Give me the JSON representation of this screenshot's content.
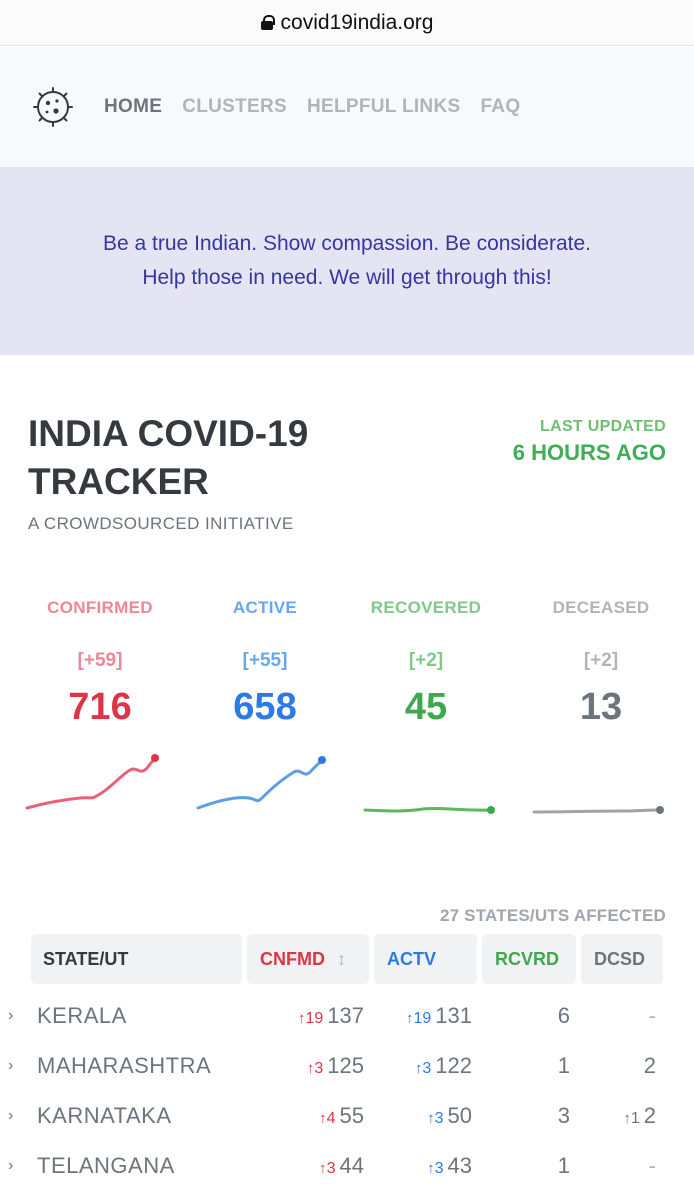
{
  "browser": {
    "url": "covid19india.org"
  },
  "nav": {
    "items": [
      {
        "label": "HOME",
        "active": true
      },
      {
        "label": "CLUSTERS",
        "active": false
      },
      {
        "label": "HELPFUL LINKS",
        "active": false
      },
      {
        "label": "FAQ",
        "active": false
      }
    ]
  },
  "banner": {
    "message": "Be a true Indian. Show compassion. Be considerate. Help those in need. We will get through this!"
  },
  "header": {
    "title": "INDIA COVID-19 TRACKER",
    "subtitle": "A CROWDSOURCED INITIATIVE",
    "last_updated_label": "LAST UPDATED",
    "last_updated_value": "6 HOURS AGO"
  },
  "stats": [
    {
      "label": "CONFIRMED",
      "delta": "[+59]",
      "value": "716",
      "color": "#dc3545",
      "label_color": "#f08596"
    },
    {
      "label": "ACTIVE",
      "delta": "[+55]",
      "value": "658",
      "color": "#2c7be5",
      "label_color": "#66a8ef"
    },
    {
      "label": "RECOVERED",
      "delta": "[+2]",
      "value": "45",
      "color": "#3fa84f",
      "label_color": "#7fc98a"
    },
    {
      "label": "DECEASED",
      "delta": "[+2]",
      "value": "13",
      "color": "#6c757d",
      "label_color": "#b0b5ba"
    }
  ],
  "table": {
    "affected": "27 STATES/UTS AFFECTED",
    "headers": {
      "state": "STATE/UT",
      "confirmed": "CNFMD",
      "active": "ACTV",
      "recovered": "RCVRD",
      "deceased": "DCSD"
    },
    "colors": {
      "confirmed": "#dc3545",
      "active": "#2c7be5",
      "recovered": "#3fa84f",
      "deceased": "#6c757d"
    },
    "rows": [
      {
        "state": "KERALA",
        "confirmed_delta": "19",
        "confirmed": "137",
        "active_delta": "19",
        "active": "131",
        "recovered": "6",
        "deceased_delta": "",
        "deceased": "-"
      },
      {
        "state": "MAHARASHTRA",
        "confirmed_delta": "3",
        "confirmed": "125",
        "active_delta": "3",
        "active": "122",
        "recovered": "1",
        "deceased_delta": "",
        "deceased": "2"
      },
      {
        "state": "KARNATAKA",
        "confirmed_delta": "4",
        "confirmed": "55",
        "active_delta": "3",
        "active": "50",
        "recovered": "3",
        "deceased_delta": "1",
        "deceased": "2"
      },
      {
        "state": "TELANGANA",
        "confirmed_delta": "3",
        "confirmed": "44",
        "active_delta": "3",
        "active": "43",
        "recovered": "1",
        "deceased_delta": "",
        "deceased": "-"
      }
    ]
  }
}
